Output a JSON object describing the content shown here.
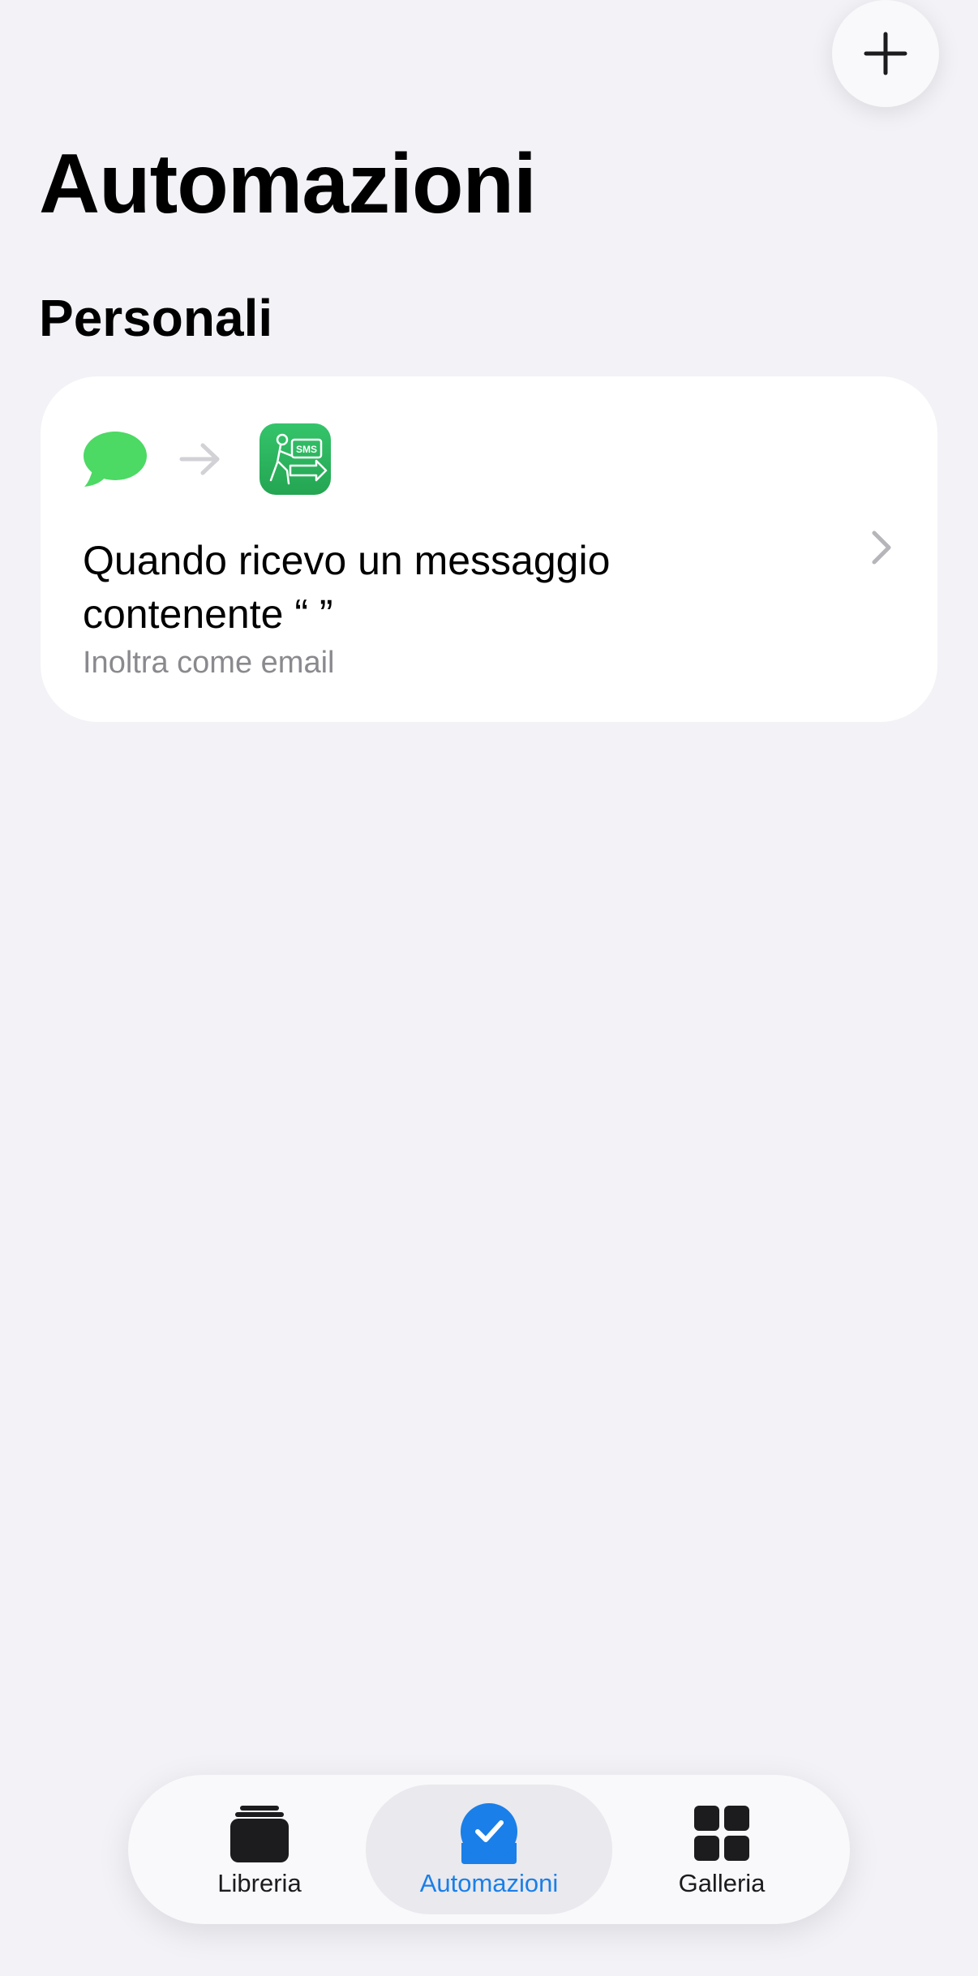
{
  "header": {
    "title": "Automazioni",
    "add_icon": "plus-icon"
  },
  "section": {
    "title": "Personali"
  },
  "automation": {
    "trigger_icon": "messages-bubble-icon",
    "arrow_icon": "arrow-right-icon",
    "action_icon": "sms-forward-shortcut-icon",
    "action_icon_text": "SMS",
    "title": "Quando ricevo un messaggio\ncontenente “ ”",
    "subtitle": "Inoltra come email",
    "chevron_icon": "chevron-right-icon"
  },
  "tabbar": {
    "active": "Automazioni",
    "accent_color": "#1a7fe8",
    "items": [
      {
        "label": "Libreria",
        "icon": "stack-icon"
      },
      {
        "label": "Automazioni",
        "icon": "checkmark-circle-icon"
      },
      {
        "label": "Galleria",
        "icon": "grid-icon"
      }
    ]
  }
}
